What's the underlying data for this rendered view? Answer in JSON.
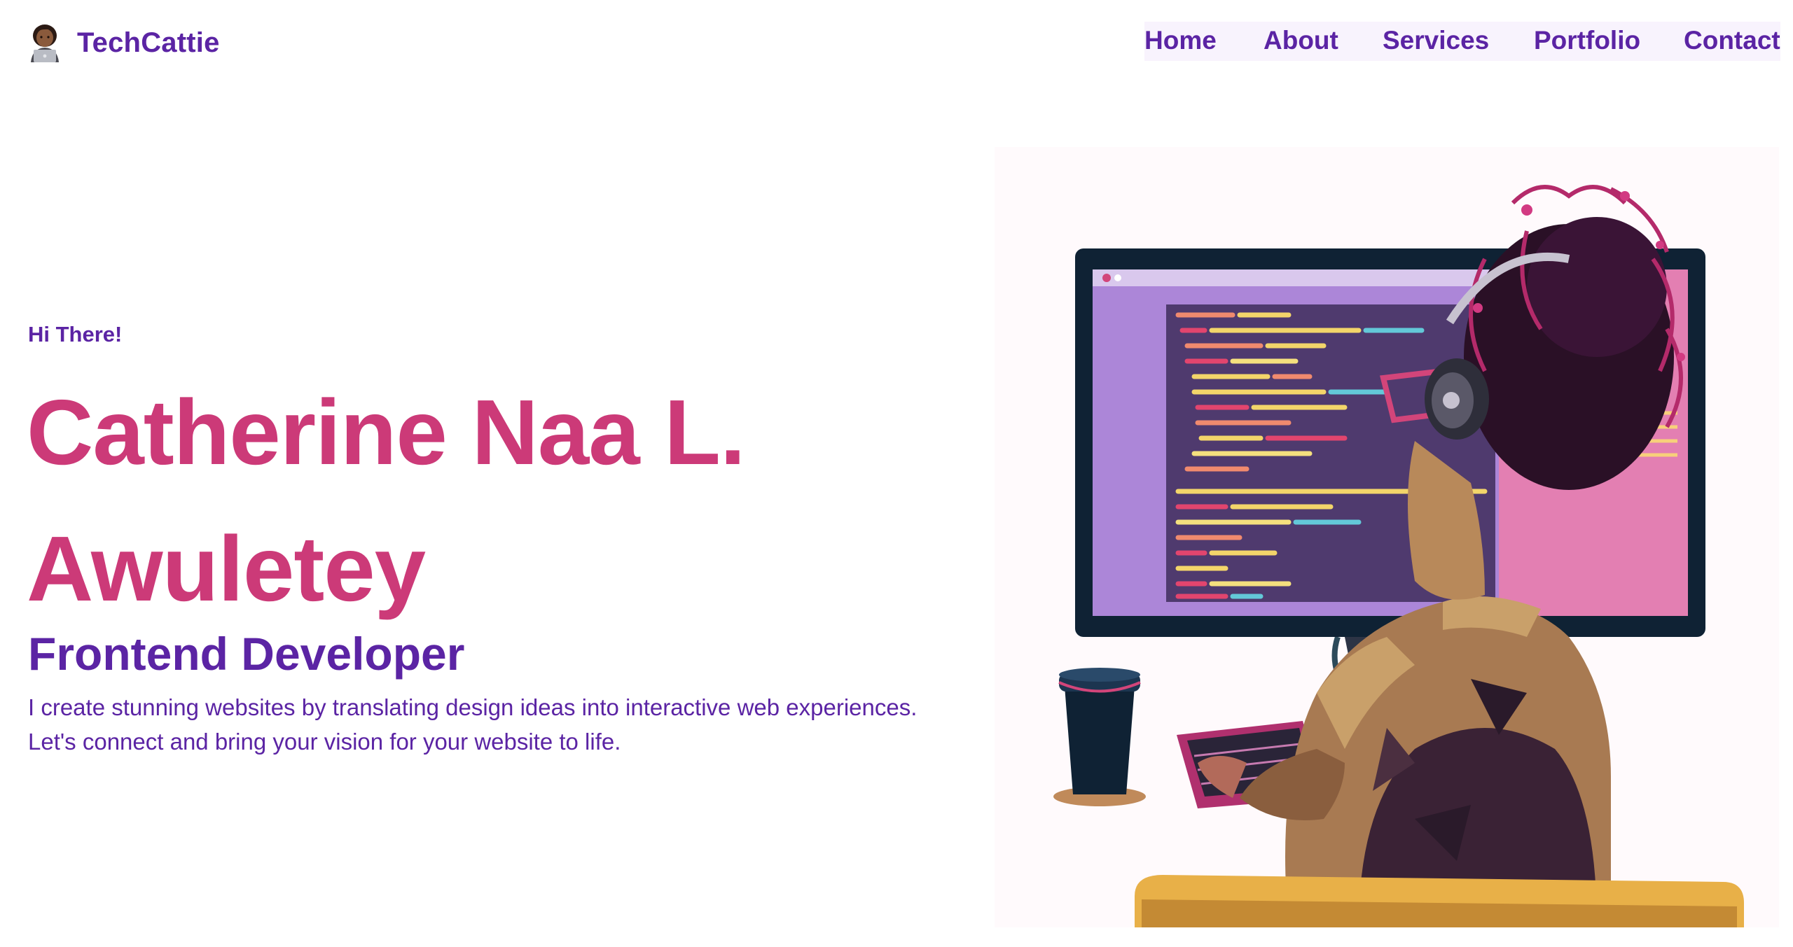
{
  "brand": {
    "name": "TechCattie",
    "avatar_icon": "woman-technologist-icon"
  },
  "nav": {
    "items": [
      {
        "label": "Home"
      },
      {
        "label": "About"
      },
      {
        "label": "Services"
      },
      {
        "label": "Portfolio"
      },
      {
        "label": "Contact"
      }
    ]
  },
  "hero": {
    "greeting": "Hi There!",
    "name_line1": "Catherine Naa L.",
    "name_line2": "Awuletey",
    "role": "Frontend Developer",
    "description_line1": "I create stunning websites by translating design ideas into interactive web experiences.",
    "description_line2": "Let's connect and bring your vision for your website to life."
  },
  "colors": {
    "primary_purple": "#5b24a4",
    "accent_pink": "#cc3a78",
    "nav_background": "#f8f3fd",
    "page_background": "#ffffff"
  },
  "illustration": {
    "subject": "developer-at-computer-illustration"
  }
}
